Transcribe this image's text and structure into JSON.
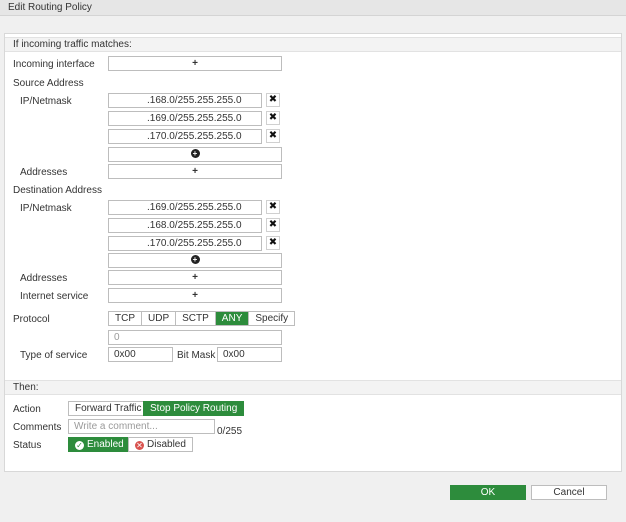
{
  "window": {
    "title": "Edit Routing Policy"
  },
  "match_section": {
    "heading": "If incoming traffic matches:",
    "incoming_interface_label": "Incoming interface",
    "source_address_label": "Source Address",
    "ip_netmask_label": "IP/Netmask",
    "source_ips": [
      ".168.0/255.255.255.0",
      ".169.0/255.255.255.0",
      ".170.0/255.255.255.0"
    ],
    "addresses_label": "Addresses",
    "destination_address_label": "Destination Address",
    "destination_ips": [
      ".169.0/255.255.255.0",
      ".168.0/255.255.255.0",
      ".170.0/255.255.255.0"
    ],
    "internet_service_label": "Internet service",
    "protocol_label": "Protocol",
    "protocols": [
      "TCP",
      "UDP",
      "SCTP",
      "ANY",
      "Specify"
    ],
    "selected_protocol": "ANY",
    "protocol_number": "0",
    "type_of_service_label": "Type of service",
    "type_of_service_value": "0x00",
    "bit_mask_label": "Bit Mask",
    "bit_mask_value": "0x00",
    "add_symbol": "+"
  },
  "then_section": {
    "heading": "Then:",
    "action_label": "Action",
    "action_options": [
      "Forward Traffic",
      "Stop Policy Routing"
    ],
    "selected_action": "Stop Policy Routing",
    "comments_label": "Comments",
    "comments_placeholder": "Write a comment...",
    "comments_counter": "0/255",
    "status_label": "Status",
    "status_enabled": "Enabled",
    "status_disabled": "Disabled",
    "selected_status": "Enabled"
  },
  "footer": {
    "ok_label": "OK",
    "cancel_label": "Cancel"
  },
  "icons": {
    "remove": "close-icon",
    "add_entry": "add-circle-icon",
    "enabled": "check-circle-icon",
    "disabled": "block-circle-icon"
  },
  "colors": {
    "accent_green": "#2d8c3c",
    "disabled_red": "#d9534f"
  }
}
